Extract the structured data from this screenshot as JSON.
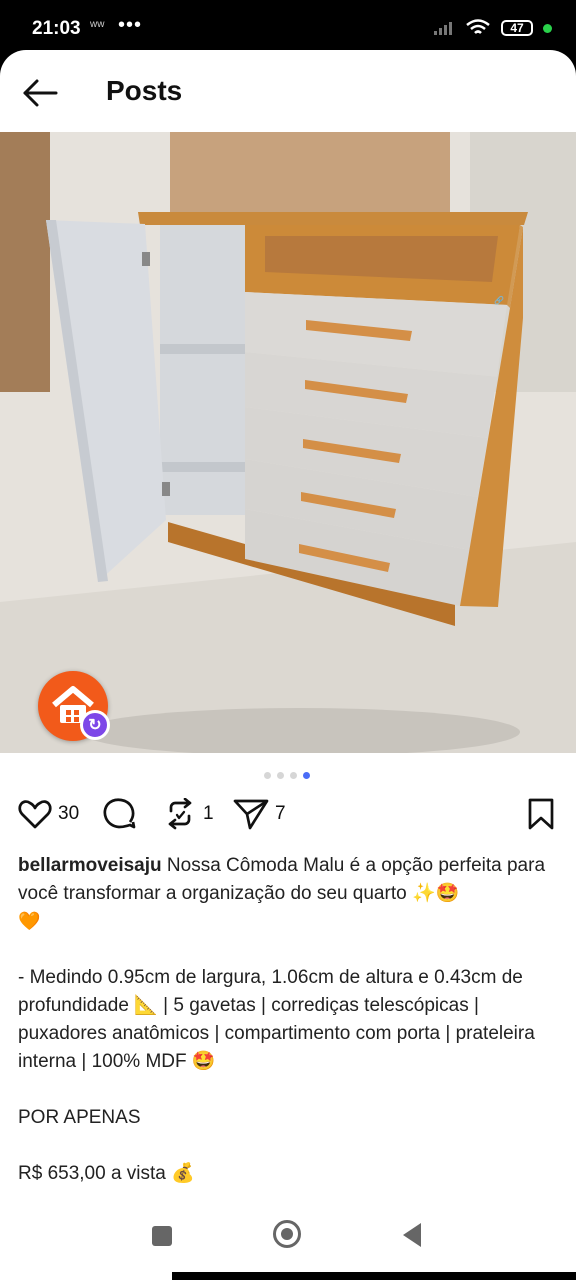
{
  "status_bar": {
    "time": "21:03",
    "notification": "ww",
    "dots": "•••",
    "battery": "47"
  },
  "header": {
    "title": "Posts"
  },
  "post": {
    "image_alt": "Cômoda Malu",
    "carousel": {
      "total": 4,
      "active": 4
    },
    "actions": {
      "likes": "30",
      "reposts": "1",
      "shares": "7"
    },
    "caption": {
      "username": "bellarmoveisaju",
      "intro": " Nossa Cômoda Malu é a opção perfeita para você transformar a organização do seu quarto ✨🤩",
      "heart": "🧡",
      "details": "- Medindo 0.95cm de largura, 1.06cm de altura e 0.43cm de profundidade 📐 | 5 gavetas | corrediças telescópicas | puxadores anatômicos | compartimento com porta | prateleira interna | 100% MDF 🤩",
      "offer": "POR APENAS",
      "price": "R$ 653,00 a vista 💰"
    }
  },
  "colors": {
    "accent": "#4a6cf7",
    "avatar": "#f25a1a",
    "badge": "#7d47e8"
  }
}
